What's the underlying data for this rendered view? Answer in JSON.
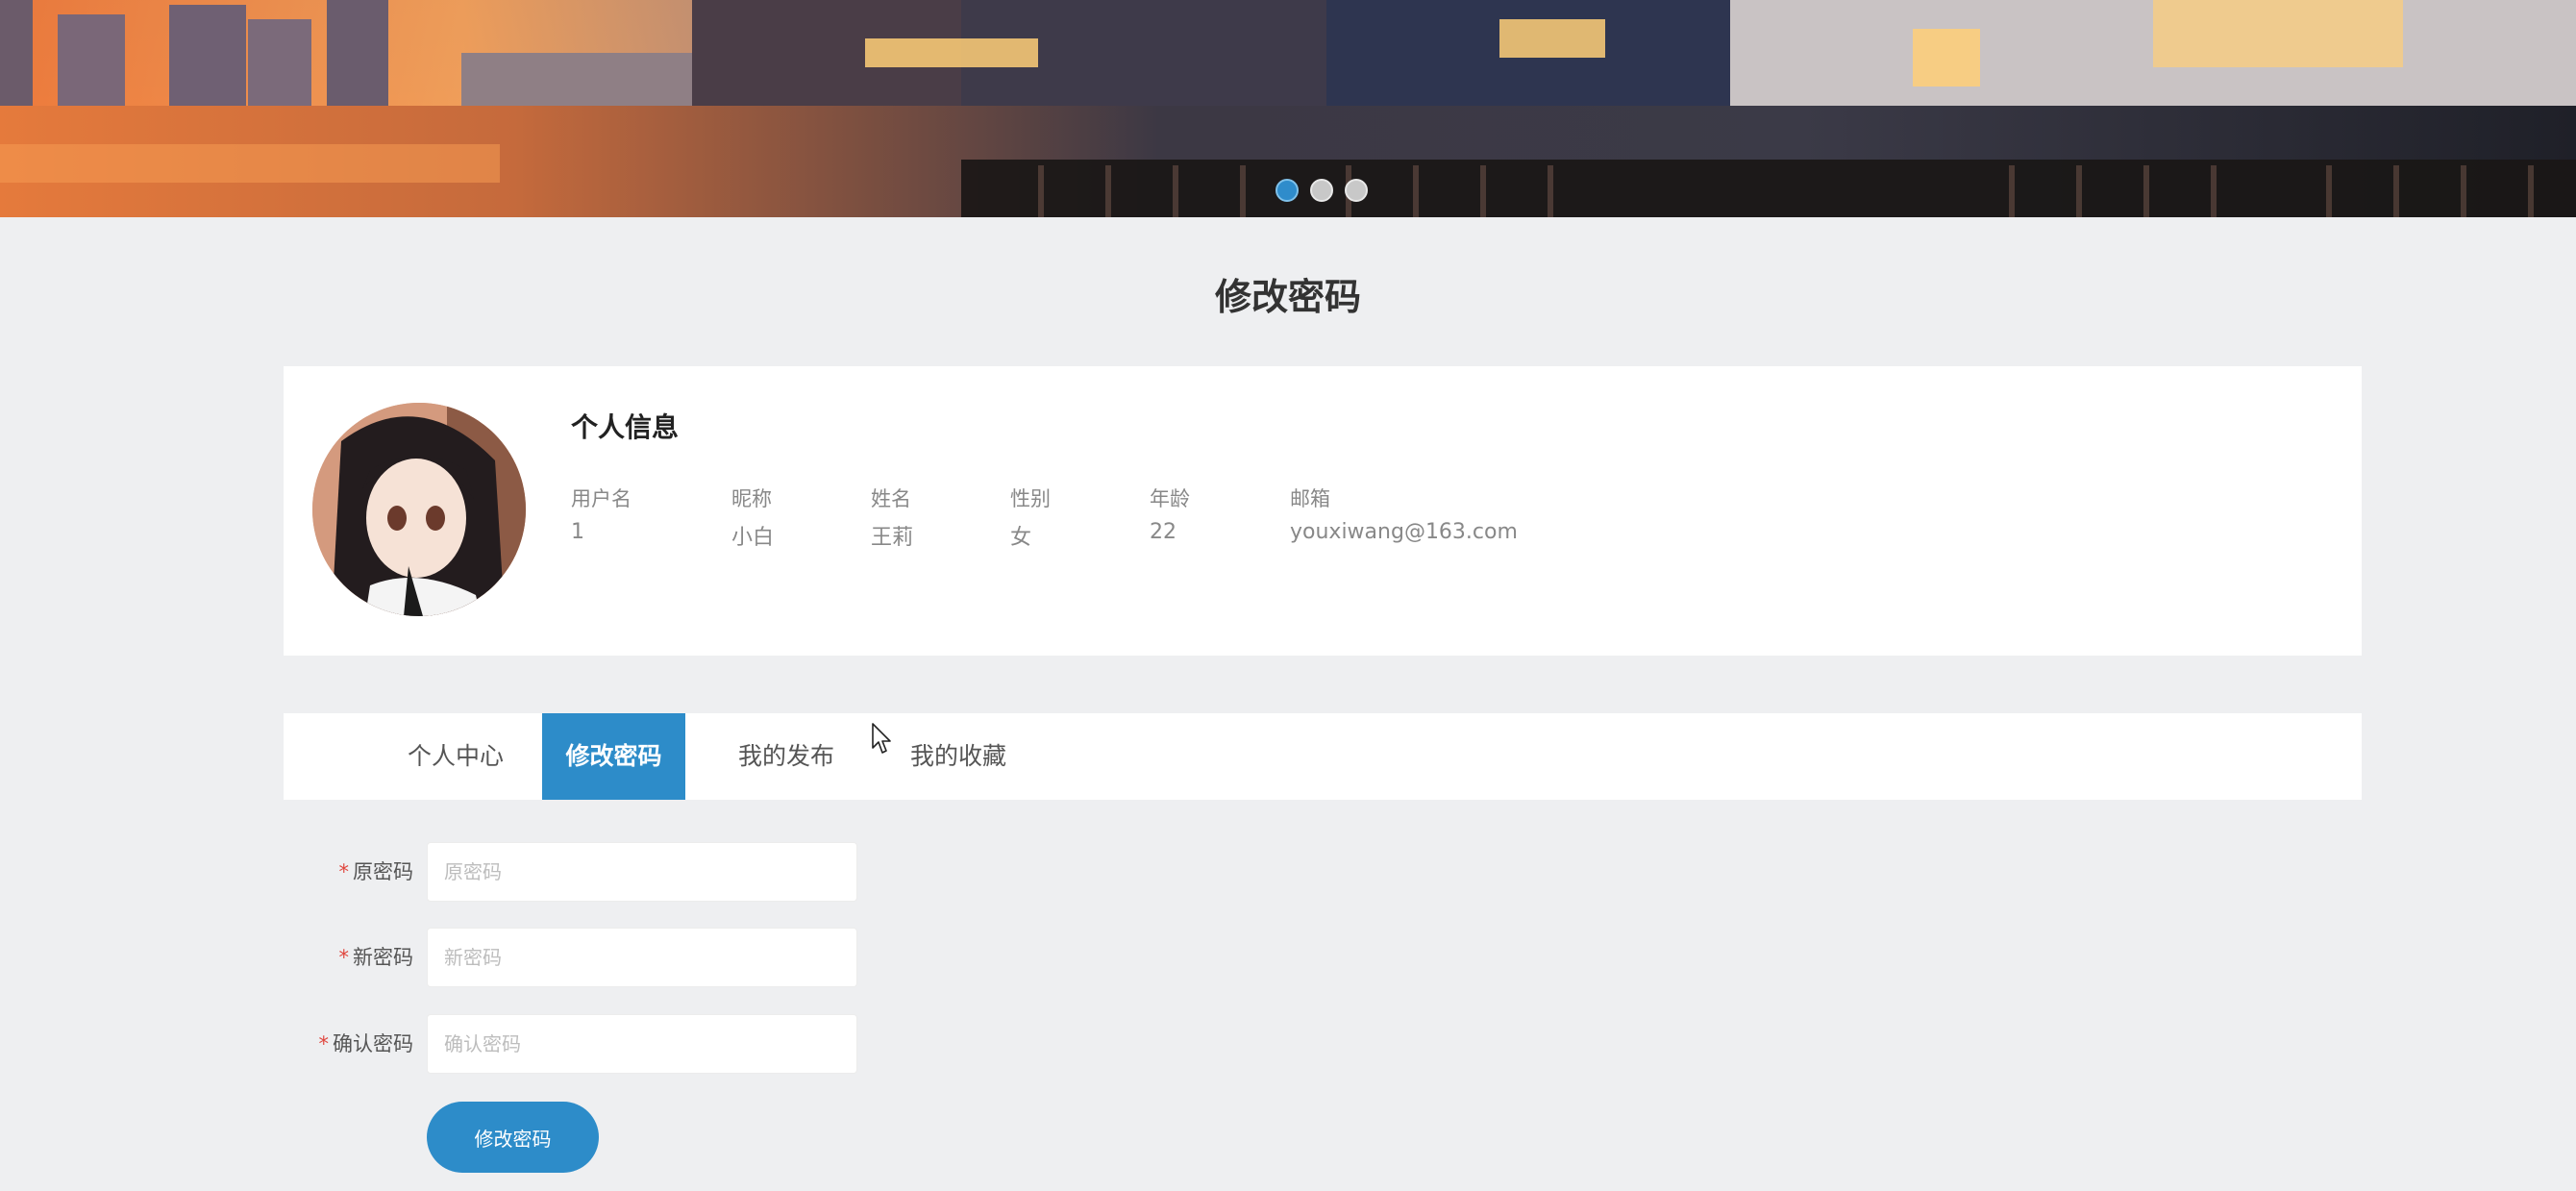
{
  "banner": {
    "dots": 3,
    "active_dot": 0
  },
  "page_title": "修改密码",
  "profile": {
    "title": "个人信息",
    "fields": [
      {
        "label": "用户名",
        "value": "1"
      },
      {
        "label": "昵称",
        "value": "小白"
      },
      {
        "label": "姓名",
        "value": "王莉"
      },
      {
        "label": "性别",
        "value": "女"
      },
      {
        "label": "年龄",
        "value": "22"
      },
      {
        "label": "邮箱",
        "value": "youxiwang@163.com"
      }
    ]
  },
  "tabs": [
    {
      "label": "个人中心",
      "active": false
    },
    {
      "label": "修改密码",
      "active": true
    },
    {
      "label": "我的发布",
      "active": false
    },
    {
      "label": "我的收藏",
      "active": false
    }
  ],
  "form": {
    "required_mark": "*",
    "fields": [
      {
        "label": "原密码",
        "placeholder": "原密码",
        "value": ""
      },
      {
        "label": "新密码",
        "placeholder": "新密码",
        "value": ""
      },
      {
        "label": "确认密码",
        "placeholder": "确认密码",
        "value": ""
      }
    ],
    "submit_label": "修改密码"
  },
  "colors": {
    "primary": "#2d8cc9",
    "required": "#e0463e",
    "background": "#eeeff1"
  }
}
